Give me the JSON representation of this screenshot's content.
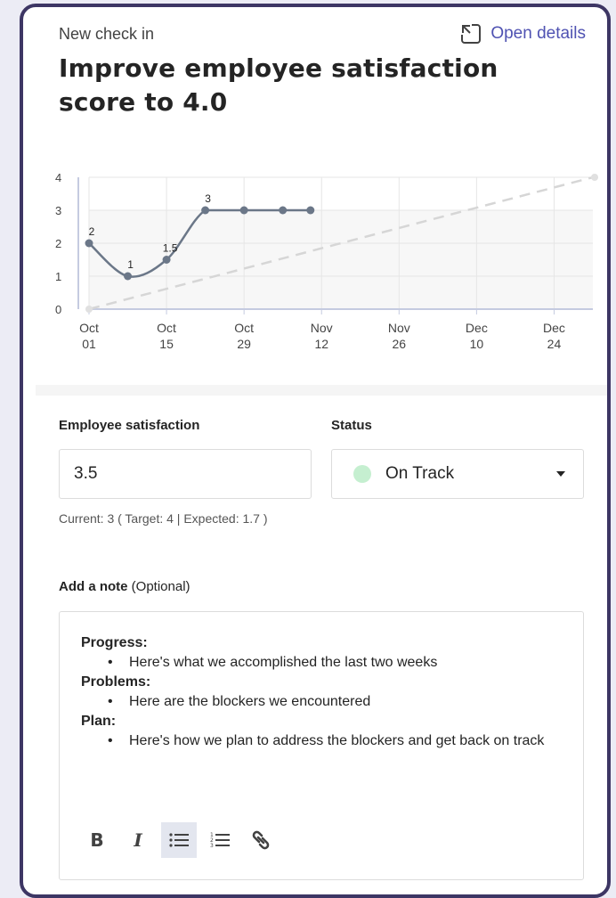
{
  "header": {
    "kicker": "New check in",
    "open_details": "Open details",
    "title": "Improve employee satisfaction score to 4.0"
  },
  "chart_data": {
    "type": "line",
    "x_ticks": [
      [
        "Oct",
        "01"
      ],
      [
        "Oct",
        "15"
      ],
      [
        "Oct",
        "29"
      ],
      [
        "Nov",
        "12"
      ],
      [
        "Nov",
        "26"
      ],
      [
        "Dec",
        "10"
      ],
      [
        "Dec",
        "24"
      ]
    ],
    "y_ticks": [
      0,
      1,
      2,
      3,
      4
    ],
    "ylim": [
      0,
      4
    ],
    "series": [
      {
        "values_day": [
          0,
          7,
          14,
          21,
          28,
          35,
          40
        ],
        "values": [
          2,
          1,
          1.5,
          3,
          3,
          3,
          3
        ],
        "labels": [
          "2",
          "1",
          "1.5",
          "3",
          "",
          "",
          ""
        ]
      },
      {
        "dashed_from_day": 0,
        "dashed_from": 0,
        "dashed_to_day": 91,
        "dashed_to": 4
      }
    ],
    "x_day_range": [
      0,
      91
    ],
    "grid": true
  },
  "metric": {
    "label": "Employee satisfaction",
    "value": "3.5",
    "current_text": "Current: 3 ( Target: 4 | Expected: 1.7 )"
  },
  "status": {
    "label": "Status",
    "value": "On Track",
    "color": "#c5efd0"
  },
  "note": {
    "label": "Add a note",
    "optional": "(Optional)",
    "sections": [
      {
        "heading": "Progress:",
        "bullet": "Here's what we accomplished the last two weeks"
      },
      {
        "heading": "Problems:",
        "bullet": "Here are the blockers we encountered"
      },
      {
        "heading": "Plan:",
        "bullet": "Here's how we plan to address the blockers and get back on track"
      }
    ]
  },
  "toolbar": {
    "bold": "B",
    "italic": "I",
    "bullets": "bulleted-list-icon",
    "numbers": "numbered-list-icon",
    "link": "link-icon"
  }
}
